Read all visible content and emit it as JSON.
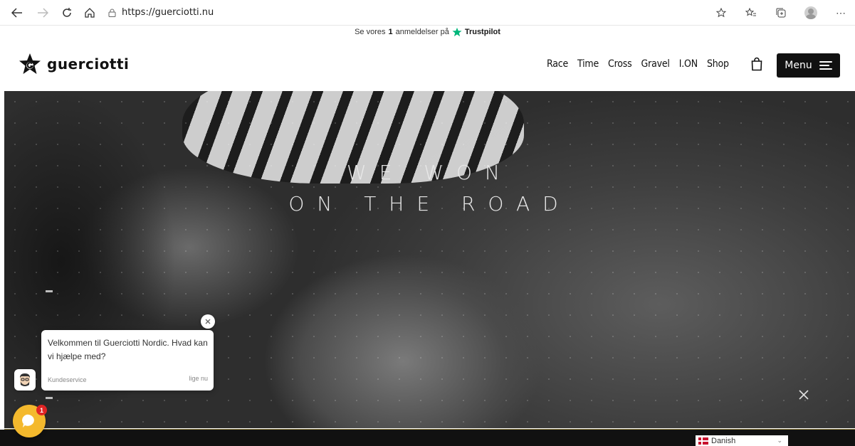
{
  "browser": {
    "url": "https://guerciotti.nu",
    "icons": [
      "back-arrow-icon",
      "forward-arrow-icon",
      "refresh-icon",
      "home-icon",
      "lock-icon",
      "favorite-add-icon",
      "favorites-icon",
      "collections-icon",
      "profile-icon",
      "more-icon"
    ]
  },
  "trustpilot": {
    "prefix": "Se vores",
    "count": "1",
    "suffix": "anmeldelser på",
    "brand": "Trustpilot",
    "star_color": "#00b67a"
  },
  "header": {
    "logo_text": "guerciotti",
    "nav": [
      "Race",
      "Time",
      "Cross",
      "Gravel",
      "I.ON",
      "Shop"
    ],
    "menu_label": "Menu"
  },
  "hero": {
    "line1": "WE WON",
    "line2": "ON THE ROAD"
  },
  "chat": {
    "message": "Velkommen til Guerciotti Nordic. Hvad kan vi hjælpe med?",
    "agent": "Kundeservice",
    "time": "lige nu",
    "badge": "1",
    "launcher_color": "#f4b92d"
  },
  "language": {
    "selected": "Danish"
  }
}
